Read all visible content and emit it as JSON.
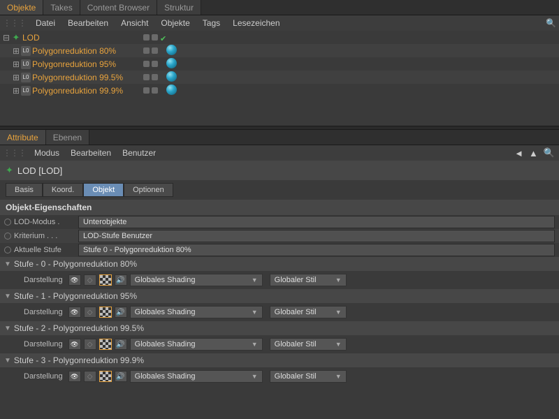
{
  "topPanel": {
    "tabs": [
      "Objekte",
      "Takes",
      "Content Browser",
      "Struktur"
    ],
    "activeTab": 0,
    "menu": [
      "Datei",
      "Bearbeiten",
      "Ansicht",
      "Objekte",
      "Tags",
      "Lesezeichen"
    ]
  },
  "objects": {
    "root": {
      "name": "LOD"
    },
    "children": [
      {
        "name": "Polygonreduktion 80%"
      },
      {
        "name": "Polygonreduktion 95%"
      },
      {
        "name": "Polygonreduktion 99.5%"
      },
      {
        "name": "Polygonreduktion 99.9%"
      }
    ]
  },
  "attrPanel": {
    "tabs": [
      "Attribute",
      "Ebenen"
    ],
    "activeTab": 0,
    "menu": [
      "Modus",
      "Bearbeiten",
      "Benutzer"
    ],
    "title": "LOD [LOD]",
    "subtabs": [
      "Basis",
      "Koord.",
      "Objekt",
      "Optionen"
    ],
    "activeSubtab": 2,
    "sectionHeader": "Objekt-Eigenschaften",
    "props": [
      {
        "label": "LOD-Modus .",
        "value": "Unterobjekte"
      },
      {
        "label": "Kriterium  . . .",
        "value": "LOD-Stufe Benutzer"
      },
      {
        "label": "Aktuelle Stufe",
        "value": "Stufe 0 - Polygonreduktion 80%"
      }
    ],
    "stufen": [
      {
        "header": "Stufe - 0 - Polygonreduktion 80%",
        "darstellung": "Darstellung",
        "shading": "Globales Shading",
        "stil": "Globaler Stil"
      },
      {
        "header": "Stufe - 1 - Polygonreduktion 95%",
        "darstellung": "Darstellung",
        "shading": "Globales Shading",
        "stil": "Globaler Stil"
      },
      {
        "header": "Stufe - 2 - Polygonreduktion 99.5%",
        "darstellung": "Darstellung",
        "shading": "Globales Shading",
        "stil": "Globaler Stil"
      },
      {
        "header": "Stufe - 3 - Polygonreduktion 99.9%",
        "darstellung": "Darstellung",
        "shading": "Globales Shading",
        "stil": "Globaler Stil"
      }
    ]
  }
}
